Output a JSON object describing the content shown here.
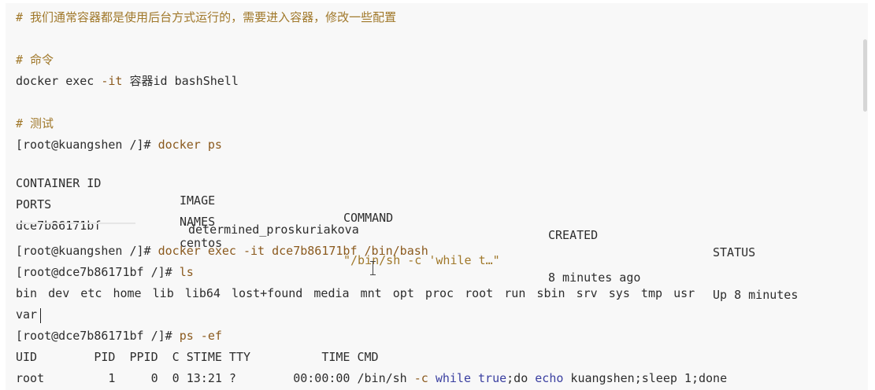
{
  "lines": {
    "comment1": "# 我们通常容器都是使用后台方式运行的，需要进入容器，修改一些配置",
    "comment2": "# 命令",
    "syntax_cmd": "docker exec ",
    "syntax_flag": "-it",
    "syntax_rest": " 容器id bashShell",
    "comment3": "# 测试",
    "prompt1": "[root@kuangshen /]# ",
    "cmd1": "docker ps",
    "prompt2": "[root@kuangshen /]# ",
    "cmd2": "docker exec -it dce7b86171bf /bin/bash",
    "prompt3": "[root@dce7b86171bf /]# ",
    "cmd3": "ls",
    "ls_output": "bin  dev  etc  home  lib  lib64  lost+found  media  mnt  opt  proc  root  run  sbin  srv  sys  tmp  usr",
    "ls_output2": "var",
    "prompt4": "[root@dce7b86171bf /]# ",
    "cmd4": "ps -ef"
  },
  "docker_ps": {
    "headers": [
      "CONTAINER ID",
      "IMAGE",
      "COMMAND",
      "CREATED",
      "STATUS"
    ],
    "headers2": [
      "PORTS",
      "NAMES"
    ],
    "row": {
      "container_id": "dce7b86171bf",
      "image": "centos",
      "command": "\"/bin/sh -c 'while t…\"",
      "created": "8 minutes ago",
      "status": "Up 8 minutes",
      "names": "determined_proskuriakova"
    }
  },
  "ps_ef": {
    "header": "UID        PID  PPID  C STIME TTY          TIME CMD",
    "row_pre": "root         1     0  0 13:21 ?        00:00:00 /bin/sh ",
    "row_flag": "-c",
    "row_mid1": " ",
    "row_kw1": "while",
    "row_mid2": " ",
    "row_kw2": "true",
    "row_mid3": ";do ",
    "row_kw3": "echo",
    "row_post": " kuangshen;sleep 1;done"
  },
  "colors": {
    "background": "#f8f8f8",
    "comment": "#a0782a",
    "command": "#8b5a1e",
    "keyword": "#3a3fa0"
  }
}
